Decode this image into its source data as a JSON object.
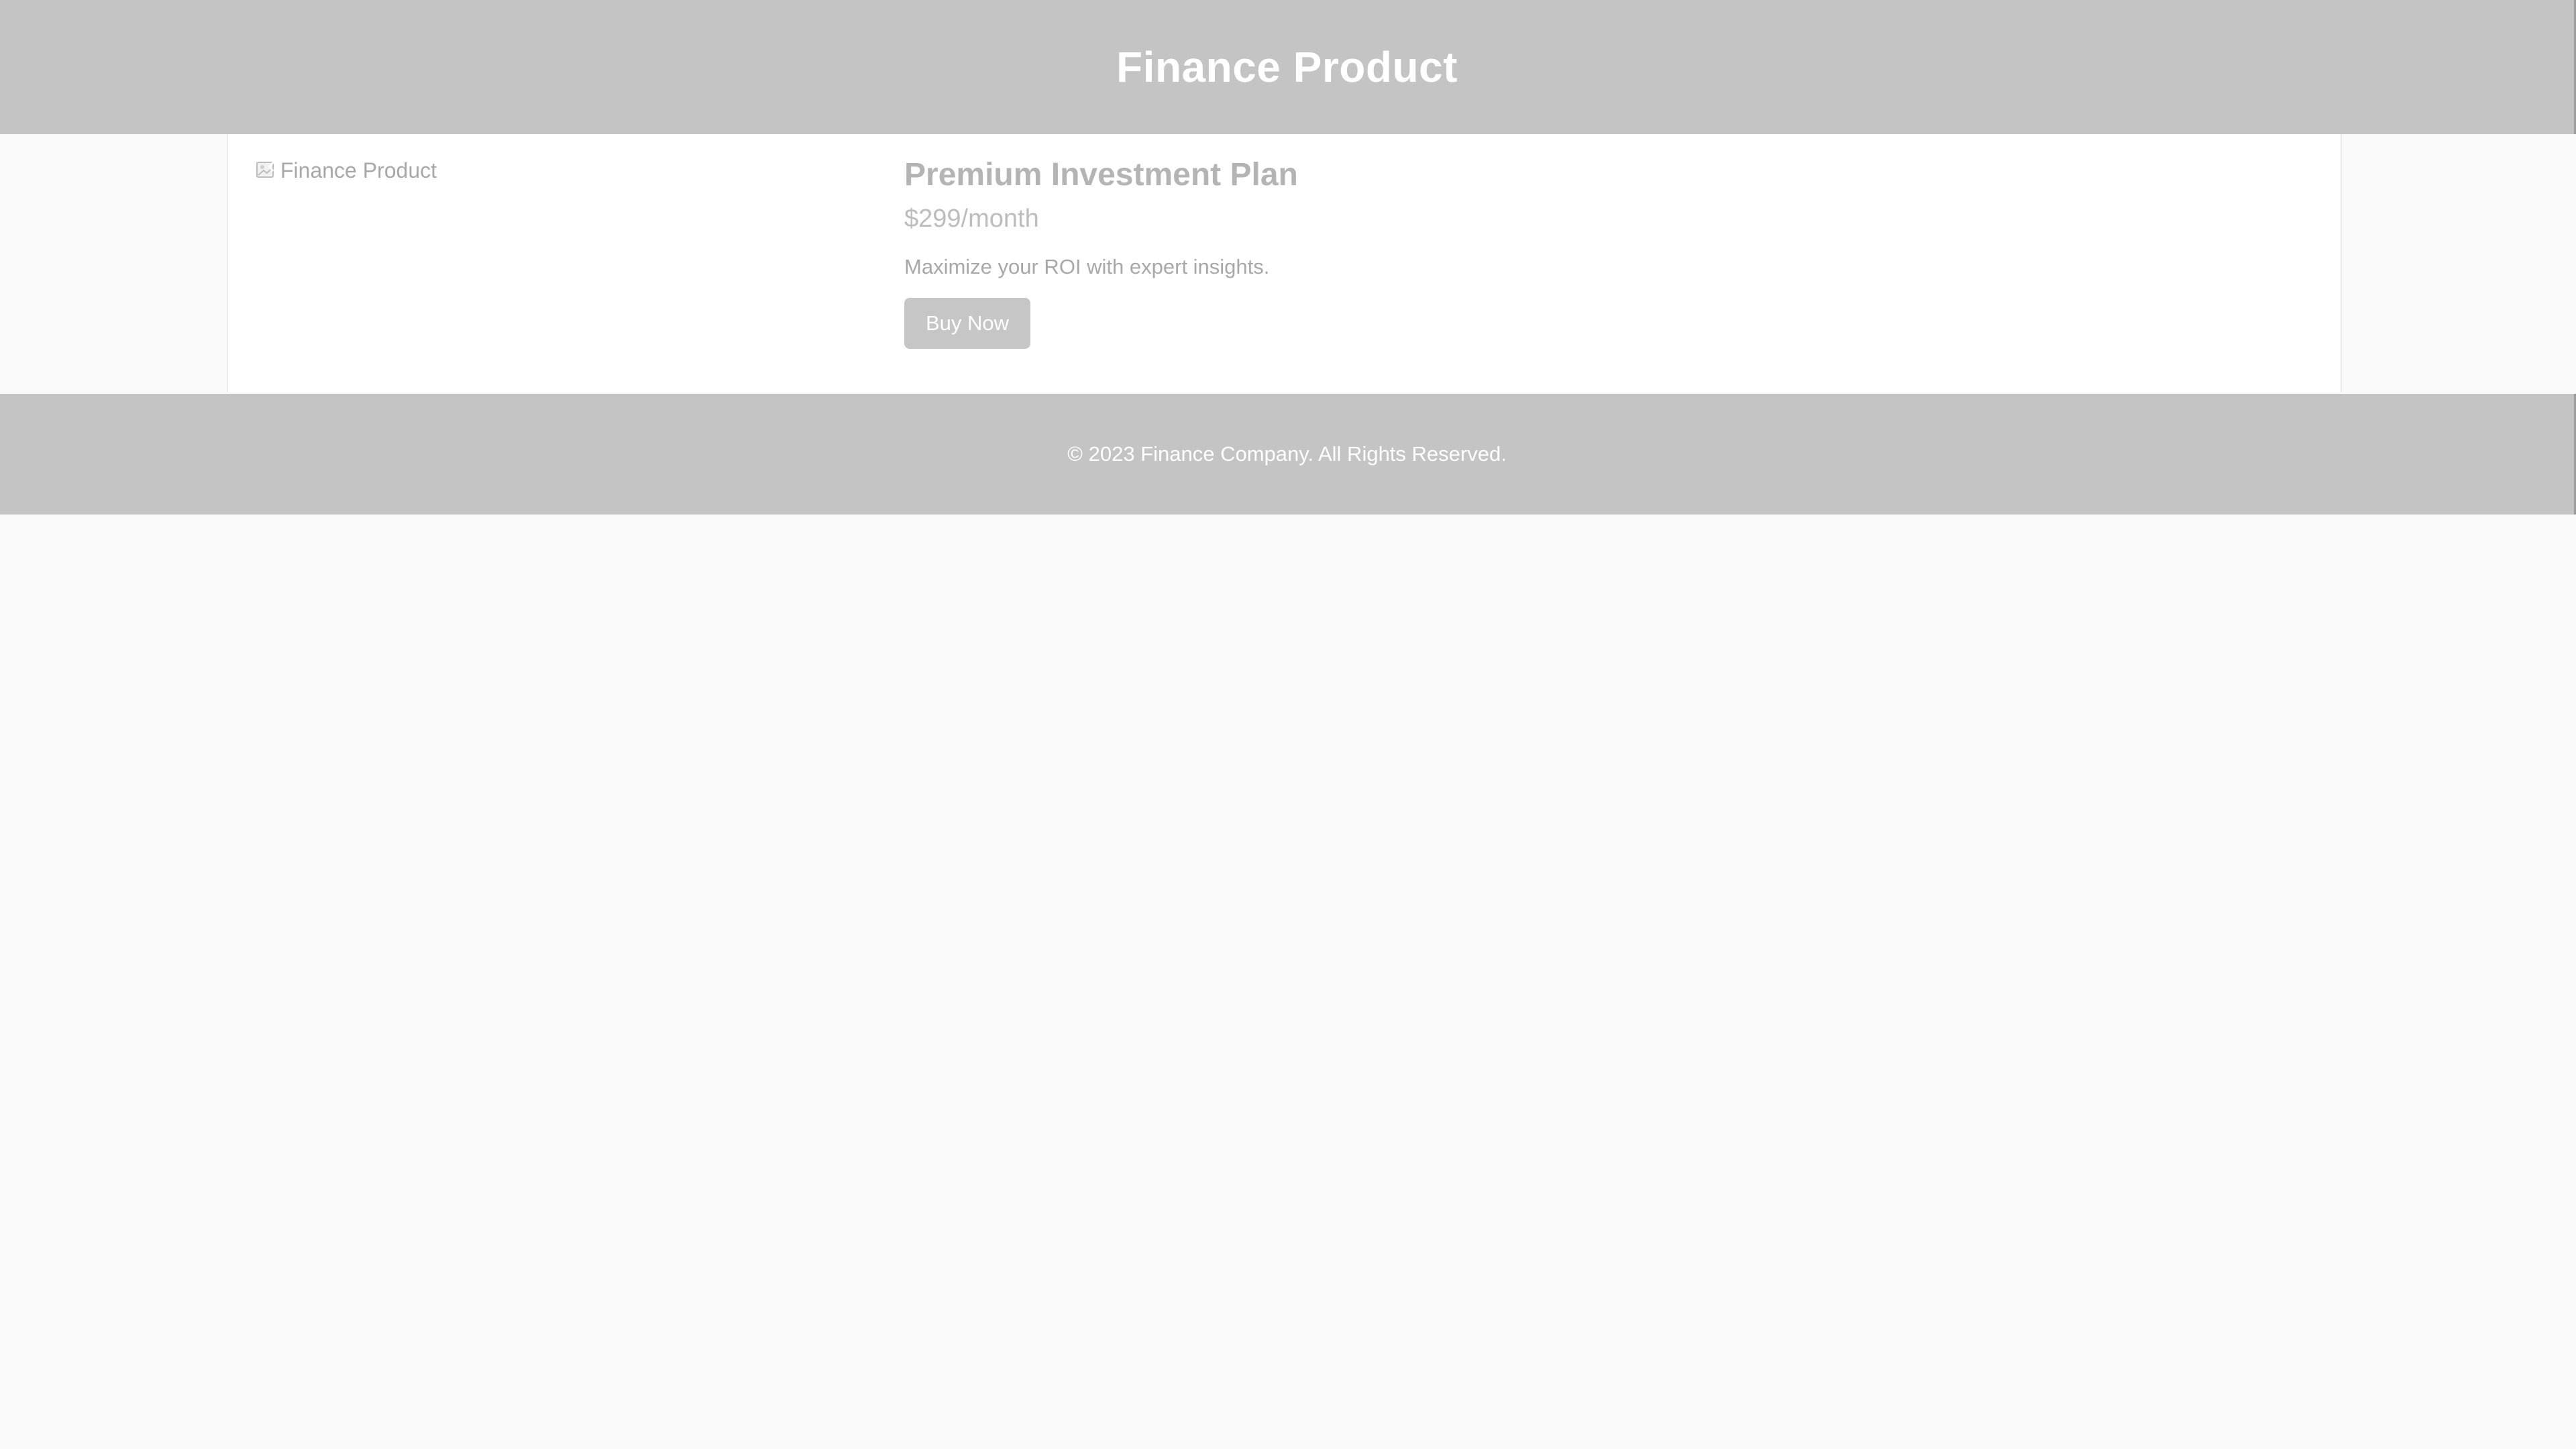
{
  "header": {
    "title": "Finance Product"
  },
  "product": {
    "image_alt": "Finance Product",
    "name": "Premium Investment Plan",
    "price": "$299/month",
    "description": "Maximize your ROI with expert insights.",
    "buy_label": "Buy Now"
  },
  "footer": {
    "copyright": "© 2023 Finance Company. All Rights Reserved."
  },
  "colors": {
    "header_bg": "#c4c4c4",
    "page_bg": "#fafafa",
    "button_bg": "#c6c6c6"
  },
  "icons": {
    "image_placeholder": "broken-image-icon"
  }
}
